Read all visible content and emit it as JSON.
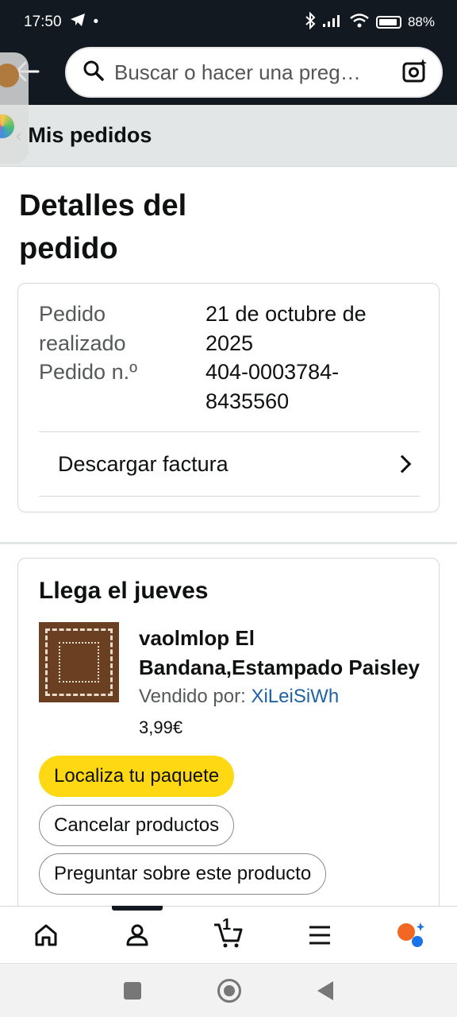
{
  "status_bar": {
    "time": "17:50",
    "dot": "•",
    "battery": "88%",
    "battery_level": 0.88
  },
  "header": {
    "search_placeholder": "Buscar o hacer una preg…"
  },
  "breadcrumb": {
    "label": "Mis pedidos"
  },
  "page": {
    "title": "Detalles del pedido"
  },
  "order_info": {
    "placed_label": "Pedido realizado",
    "placed_value": "21 de octubre de 2025",
    "number_label": "Pedido n.º",
    "number_value": "404-0003784-8435560",
    "invoice_label": "Descargar factura"
  },
  "shipment": {
    "arrival": "Llega el jueves",
    "product_title": "vaolmlop El Bandana,Estampado Paisley",
    "seller_prefix": "Vendido por: ",
    "seller_name": "XiLeiSiWh",
    "price": "3,99€",
    "buttons": {
      "track": "Localiza tu paquete",
      "cancel": "Cancelar productos",
      "ask": "Preguntar sobre este producto"
    }
  },
  "bottom_nav": {
    "cart_count": "1"
  }
}
